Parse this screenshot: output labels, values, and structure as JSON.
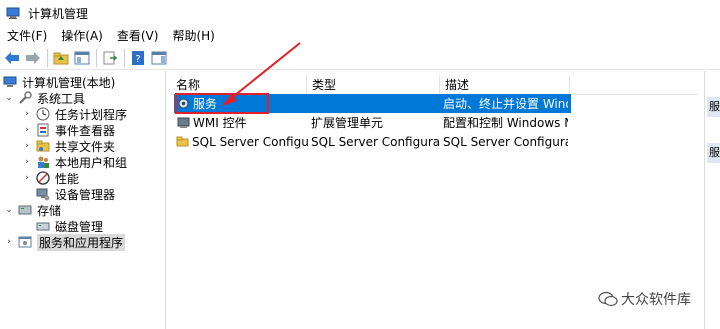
{
  "window": {
    "title": "计算机管理"
  },
  "menu": [
    {
      "label": "文件(F)"
    },
    {
      "label": "操作(A)"
    },
    {
      "label": "查看(V)"
    },
    {
      "label": "帮助(H)"
    }
  ],
  "toolbar": {
    "buttons": [
      "back-arrow-icon",
      "forward-arrow-icon",
      "up-folder-icon",
      "show-hide-tree-icon",
      "export-list-icon",
      "help-icon",
      "action-pane-icon"
    ]
  },
  "tree": {
    "root": "计算机管理(本地)",
    "system_tools": "系统工具",
    "task_scheduler": "任务计划程序",
    "event_viewer": "事件查看器",
    "shared_folders": "共享文件夹",
    "local_users": "本地用户和组",
    "performance": "性能",
    "device_manager": "设备管理器",
    "storage": "存储",
    "disk_management": "磁盘管理",
    "services_apps": "服务和应用程序"
  },
  "list": {
    "headers": [
      "名称",
      "类型",
      "描述"
    ],
    "rows": [
      {
        "name": "服务",
        "type": "",
        "desc": "启动、终止并设置 Wind..."
      },
      {
        "name": "WMI 控件",
        "type": "扩展管理单元",
        "desc": "配置和控制 Windows M..."
      },
      {
        "name": "SQL Server Configura...",
        "type": "SQL Server Configurati...",
        "desc": "SQL Server Configurati..."
      }
    ]
  },
  "actions": {
    "tab1": "服",
    "tab2": "服"
  },
  "watermark": {
    "text": "大众软件库"
  },
  "colors": {
    "selection": "#0078d7",
    "annotation": "#e0202a"
  }
}
